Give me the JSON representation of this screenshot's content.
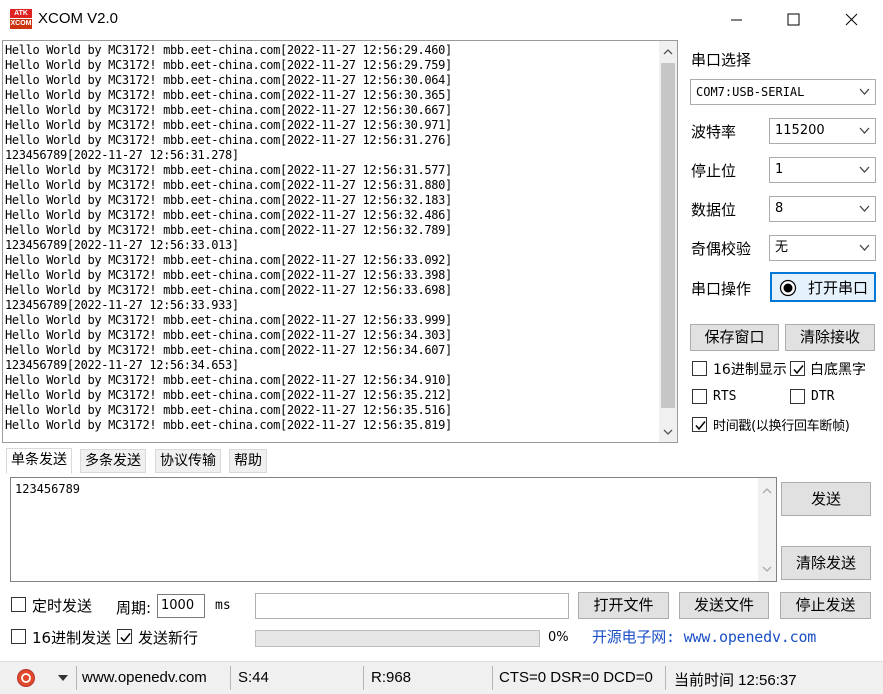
{
  "window": {
    "title": "XCOM V2.0",
    "logo_top": "ATK",
    "logo_bottom": "XCOM"
  },
  "receive": {
    "lines": [
      "Hello World by MC3172! mbb.eet-china.com[2022-11-27 12:56:29.460]",
      "Hello World by MC3172! mbb.eet-china.com[2022-11-27 12:56:29.759]",
      "Hello World by MC3172! mbb.eet-china.com[2022-11-27 12:56:30.064]",
      "Hello World by MC3172! mbb.eet-china.com[2022-11-27 12:56:30.365]",
      "Hello World by MC3172! mbb.eet-china.com[2022-11-27 12:56:30.667]",
      "Hello World by MC3172! mbb.eet-china.com[2022-11-27 12:56:30.971]",
      "Hello World by MC3172! mbb.eet-china.com[2022-11-27 12:56:31.276]",
      "123456789[2022-11-27 12:56:31.278]",
      "Hello World by MC3172! mbb.eet-china.com[2022-11-27 12:56:31.577]",
      "Hello World by MC3172! mbb.eet-china.com[2022-11-27 12:56:31.880]",
      "Hello World by MC3172! mbb.eet-china.com[2022-11-27 12:56:32.183]",
      "Hello World by MC3172! mbb.eet-china.com[2022-11-27 12:56:32.486]",
      "Hello World by MC3172! mbb.eet-china.com[2022-11-27 12:56:32.789]",
      "123456789[2022-11-27 12:56:33.013]",
      "Hello World by MC3172! mbb.eet-china.com[2022-11-27 12:56:33.092]",
      "Hello World by MC3172! mbb.eet-china.com[2022-11-27 12:56:33.398]",
      "Hello World by MC3172! mbb.eet-china.com[2022-11-27 12:56:33.698]",
      "123456789[2022-11-27 12:56:33.933]",
      "Hello World by MC3172! mbb.eet-china.com[2022-11-27 12:56:33.999]",
      "Hello World by MC3172! mbb.eet-china.com[2022-11-27 12:56:34.303]",
      "Hello World by MC3172! mbb.eet-china.com[2022-11-27 12:56:34.607]",
      "123456789[2022-11-27 12:56:34.653]",
      "Hello World by MC3172! mbb.eet-china.com[2022-11-27 12:56:34.910]",
      "Hello World by MC3172! mbb.eet-china.com[2022-11-27 12:56:35.212]",
      "Hello World by MC3172! mbb.eet-china.com[2022-11-27 12:56:35.516]",
      "Hello World by MC3172! mbb.eet-china.com[2022-11-27 12:56:35.819]"
    ]
  },
  "serial": {
    "port_label": "串口选择",
    "port_value": "COM7:USB-SERIAL",
    "baud_label": "波特率",
    "baud_value": "115200",
    "stop_label": "停止位",
    "stop_value": "1",
    "data_label": "数据位",
    "data_value": "8",
    "parity_label": "奇偶校验",
    "parity_value": "无",
    "op_label": "串口操作",
    "open_button": "打开串口"
  },
  "options": {
    "save_window": "保存窗口",
    "clear_receive": "清除接收",
    "hex_display": "16进制显示",
    "white_bg": "白底黑字",
    "rts": "RTS",
    "dtr": "DTR",
    "timestamp": "时间戳(以换行回车断帧)",
    "hex_display_checked": false,
    "white_bg_checked": true,
    "rts_checked": false,
    "dtr_checked": false,
    "timestamp_checked": true
  },
  "tabs": [
    "单条发送",
    "多条发送",
    "协议传输",
    "帮助"
  ],
  "send": {
    "text": "123456789",
    "send_button": "发送",
    "clear_send_button": "清除发送",
    "timed_send": "定时发送",
    "period_label": "周期:",
    "period_value": "1000",
    "period_unit": "ms",
    "open_file": "打开文件",
    "send_file": "发送文件",
    "stop_send": "停止发送",
    "hex_send": "16进制发送",
    "new_line": "发送新行",
    "new_line_checked": true,
    "progress_text": "0%",
    "promo": "开源电子网: www.openedv.com"
  },
  "status": {
    "site": "www.openedv.com",
    "sent": "S:44",
    "received": "R:968",
    "lines": "CTS=0 DSR=0 DCD=0",
    "time": "当前时间 12:56:37"
  },
  "colors": {
    "promo": "#1a4fc7",
    "accent": "#0078d7",
    "close_hover": "#e81123"
  }
}
